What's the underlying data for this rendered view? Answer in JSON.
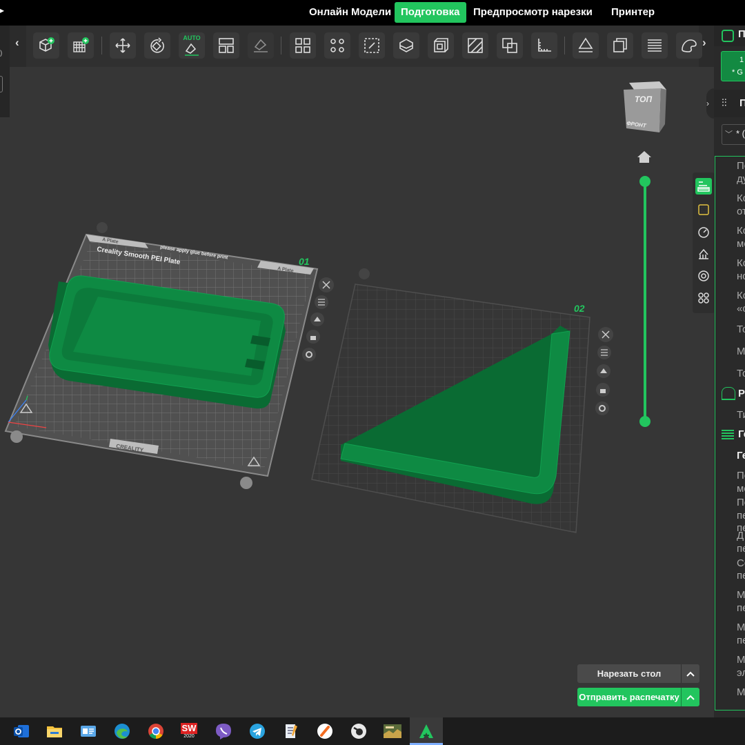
{
  "menu": {
    "tabs": [
      {
        "label": "Онлайн Модели"
      },
      {
        "label": "Подготовка"
      },
      {
        "label": "Предпросмотр нарезки"
      },
      {
        "label": "Принтер"
      }
    ]
  },
  "toolbar": {
    "auto_label": "AUTO",
    "left_chevron": "‹",
    "right_chevron": "›"
  },
  "viewcube": {
    "top": "ТОП",
    "front": "ФРОНТ"
  },
  "plates": [
    {
      "number": "01",
      "tab_left": "A Plate",
      "tab_right": "A Plate",
      "title": "Creality Smooth PEI Plate",
      "notice": "please apply glue before print",
      "brand": "CREALITY"
    },
    {
      "number": "02"
    }
  ],
  "right_panel": {
    "plate_btn_line1": "1",
    "plate_btn_line2": "* G",
    "section_settings": "П",
    "profile_select": "* (",
    "rows": [
      "По",
      "ду",
      "Ко",
      "от",
      "Ко",
      "мо",
      "Ко",
      "но",
      "Ко",
      "«о",
      "То",
      "М",
      "То"
    ],
    "section_r": "Р",
    "row_ti": "Ти",
    "section_g": "Ге",
    "sub_g": "Ге",
    "rows2": [
      "По",
      "мо",
      "По",
      "пе",
      "пе",
      "Д",
      "пе",
      "Сс",
      "пе",
      "М",
      "пе",
      "М",
      "пе",
      "М",
      "эл",
      "М"
    ]
  },
  "actions": {
    "slice": "Нарезать стол",
    "send": "Отправить распечатку"
  },
  "taskbar": {
    "apps": [
      "outlook-icon",
      "explorer-icon",
      "control-panel-icon",
      "edge-icon",
      "chrome-icon",
      "solidworks-icon",
      "viber-icon",
      "telegram-icon",
      "notepad-icon",
      "app-orange-icon",
      "app-blender-icon",
      "game-icon",
      "creality-print-icon"
    ],
    "sw_year": "2020"
  },
  "colors": {
    "accent": "#22c55e",
    "model": "#0e8a43",
    "bg": "#363636"
  }
}
